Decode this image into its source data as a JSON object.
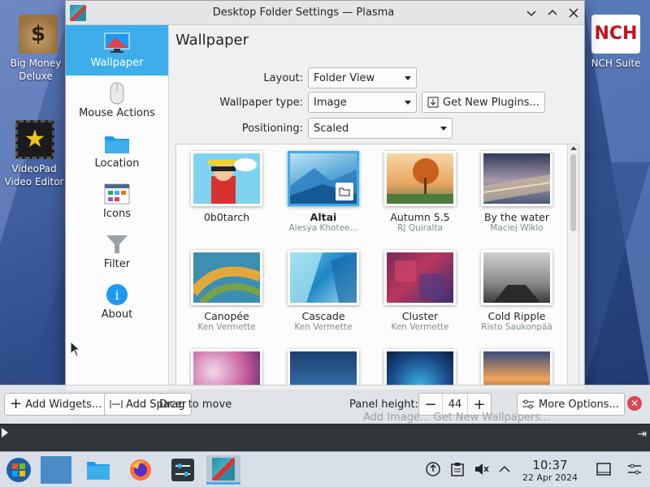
{
  "desktop": {
    "icons": [
      {
        "label": "Big Money Deluxe",
        "icon": "money-bag-icon"
      },
      {
        "label": "VideoPad Video Editor",
        "icon": "videopad-icon"
      },
      {
        "label": "NCH Suite",
        "icon": "nch-icon"
      }
    ],
    "nch_logo_text": "NCH"
  },
  "window": {
    "title": "Desktop Folder Settings — Plasma",
    "sidebar": [
      {
        "label": "Wallpaper",
        "icon": "wallpaper-icon",
        "active": true
      },
      {
        "label": "Mouse Actions",
        "icon": "mouse-icon"
      },
      {
        "label": "Location",
        "icon": "folder-icon"
      },
      {
        "label": "Icons",
        "icon": "icons-icon"
      },
      {
        "label": "Filter",
        "icon": "filter-icon"
      },
      {
        "label": "About",
        "icon": "info-icon"
      }
    ],
    "heading": "Wallpaper",
    "layout_label": "Layout:",
    "layout_value": "Folder View",
    "type_label": "Wallpaper type:",
    "type_value": "Image",
    "get_plugins": "Get New Plugins...",
    "positioning_label": "Positioning:",
    "positioning_value": "Scaled",
    "wallpapers": [
      {
        "name": "0b0tarch",
        "author": ""
      },
      {
        "name": "Altai",
        "author": "Alesya Khotee..."
      },
      {
        "name": "Autumn 5.5",
        "author": "RJ Quiralta"
      },
      {
        "name": "By the water",
        "author": "Maciej Wiklo"
      },
      {
        "name": "Canopée",
        "author": "Ken Vermette"
      },
      {
        "name": "Cascade",
        "author": "Ken Vermette"
      },
      {
        "name": "Cluster",
        "author": "Ken Vermette"
      },
      {
        "name": "Cold Ripple",
        "author": "Risto Saukonpää"
      },
      {
        "name": "",
        "author": ""
      },
      {
        "name": "",
        "author": ""
      },
      {
        "name": "",
        "author": ""
      },
      {
        "name": "",
        "author": ""
      }
    ]
  },
  "panel_edit": {
    "add_widgets": "Add Widgets...",
    "add_spacer": "Add Spacer",
    "drag_to_move": "Drag to move",
    "panel_height_label": "Panel height:",
    "panel_height_value": "44",
    "more_options": "More Options...",
    "ghost_text": "Add Image...   Get New Wallpapers..."
  },
  "taskbar": {
    "time": "10:37",
    "date": "22 Apr 2024"
  },
  "colors": {
    "accent": "#3daee9",
    "close": "#da4453"
  }
}
